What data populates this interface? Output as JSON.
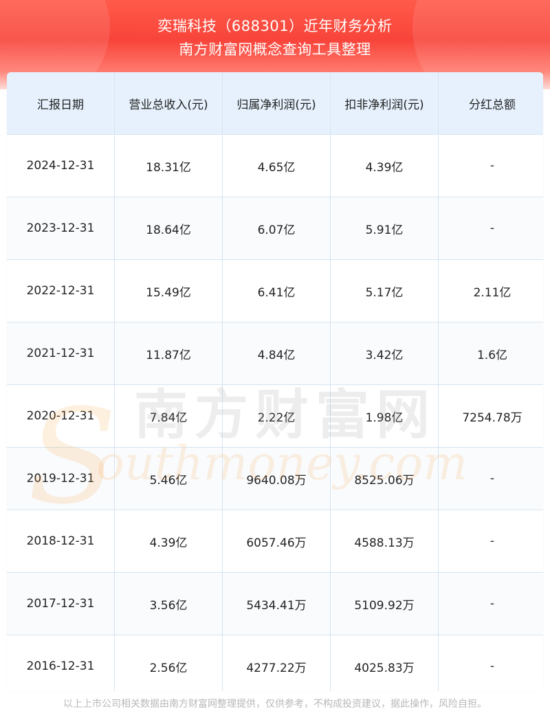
{
  "header": {
    "title_line1": "奕瑞科技（688301）近年财务分析",
    "title_line2": "南方财富网概念查询工具整理"
  },
  "table": {
    "columns": [
      "汇报日期",
      "营业总收入(元)",
      "归属净利润(元)",
      "扣非净利润(元)",
      "分红总额"
    ],
    "rows": [
      [
        "2024-12-31",
        "18.31亿",
        "4.65亿",
        "4.39亿",
        "-"
      ],
      [
        "2023-12-31",
        "18.64亿",
        "6.07亿",
        "5.91亿",
        "-"
      ],
      [
        "2022-12-31",
        "15.49亿",
        "6.41亿",
        "5.17亿",
        "2.11亿"
      ],
      [
        "2021-12-31",
        "11.87亿",
        "4.84亿",
        "3.42亿",
        "1.6亿"
      ],
      [
        "2020-12-31",
        "7.84亿",
        "2.22亿",
        "1.98亿",
        "7254.78万"
      ],
      [
        "2019-12-31",
        "5.46亿",
        "9640.08万",
        "8525.06万",
        "-"
      ],
      [
        "2018-12-31",
        "4.39亿",
        "6057.46万",
        "4588.13万",
        "-"
      ],
      [
        "2017-12-31",
        "3.56亿",
        "5434.41万",
        "5109.92万",
        "-"
      ],
      [
        "2016-12-31",
        "2.56亿",
        "4277.22万",
        "4025.83万",
        "-"
      ]
    ]
  },
  "watermark": {
    "cn": "南方财富网",
    "en": "outhmoney.com"
  },
  "footer": {
    "disclaimer": "以上上市公司相关数据由南方财富网整理提供，仅供参考，不构成投资建议，据此操作，风险自担。"
  },
  "colors": {
    "header_red": "#f8443a",
    "table_head_bg": "#e6f1fd",
    "grid_line": "#d6e4f2"
  }
}
